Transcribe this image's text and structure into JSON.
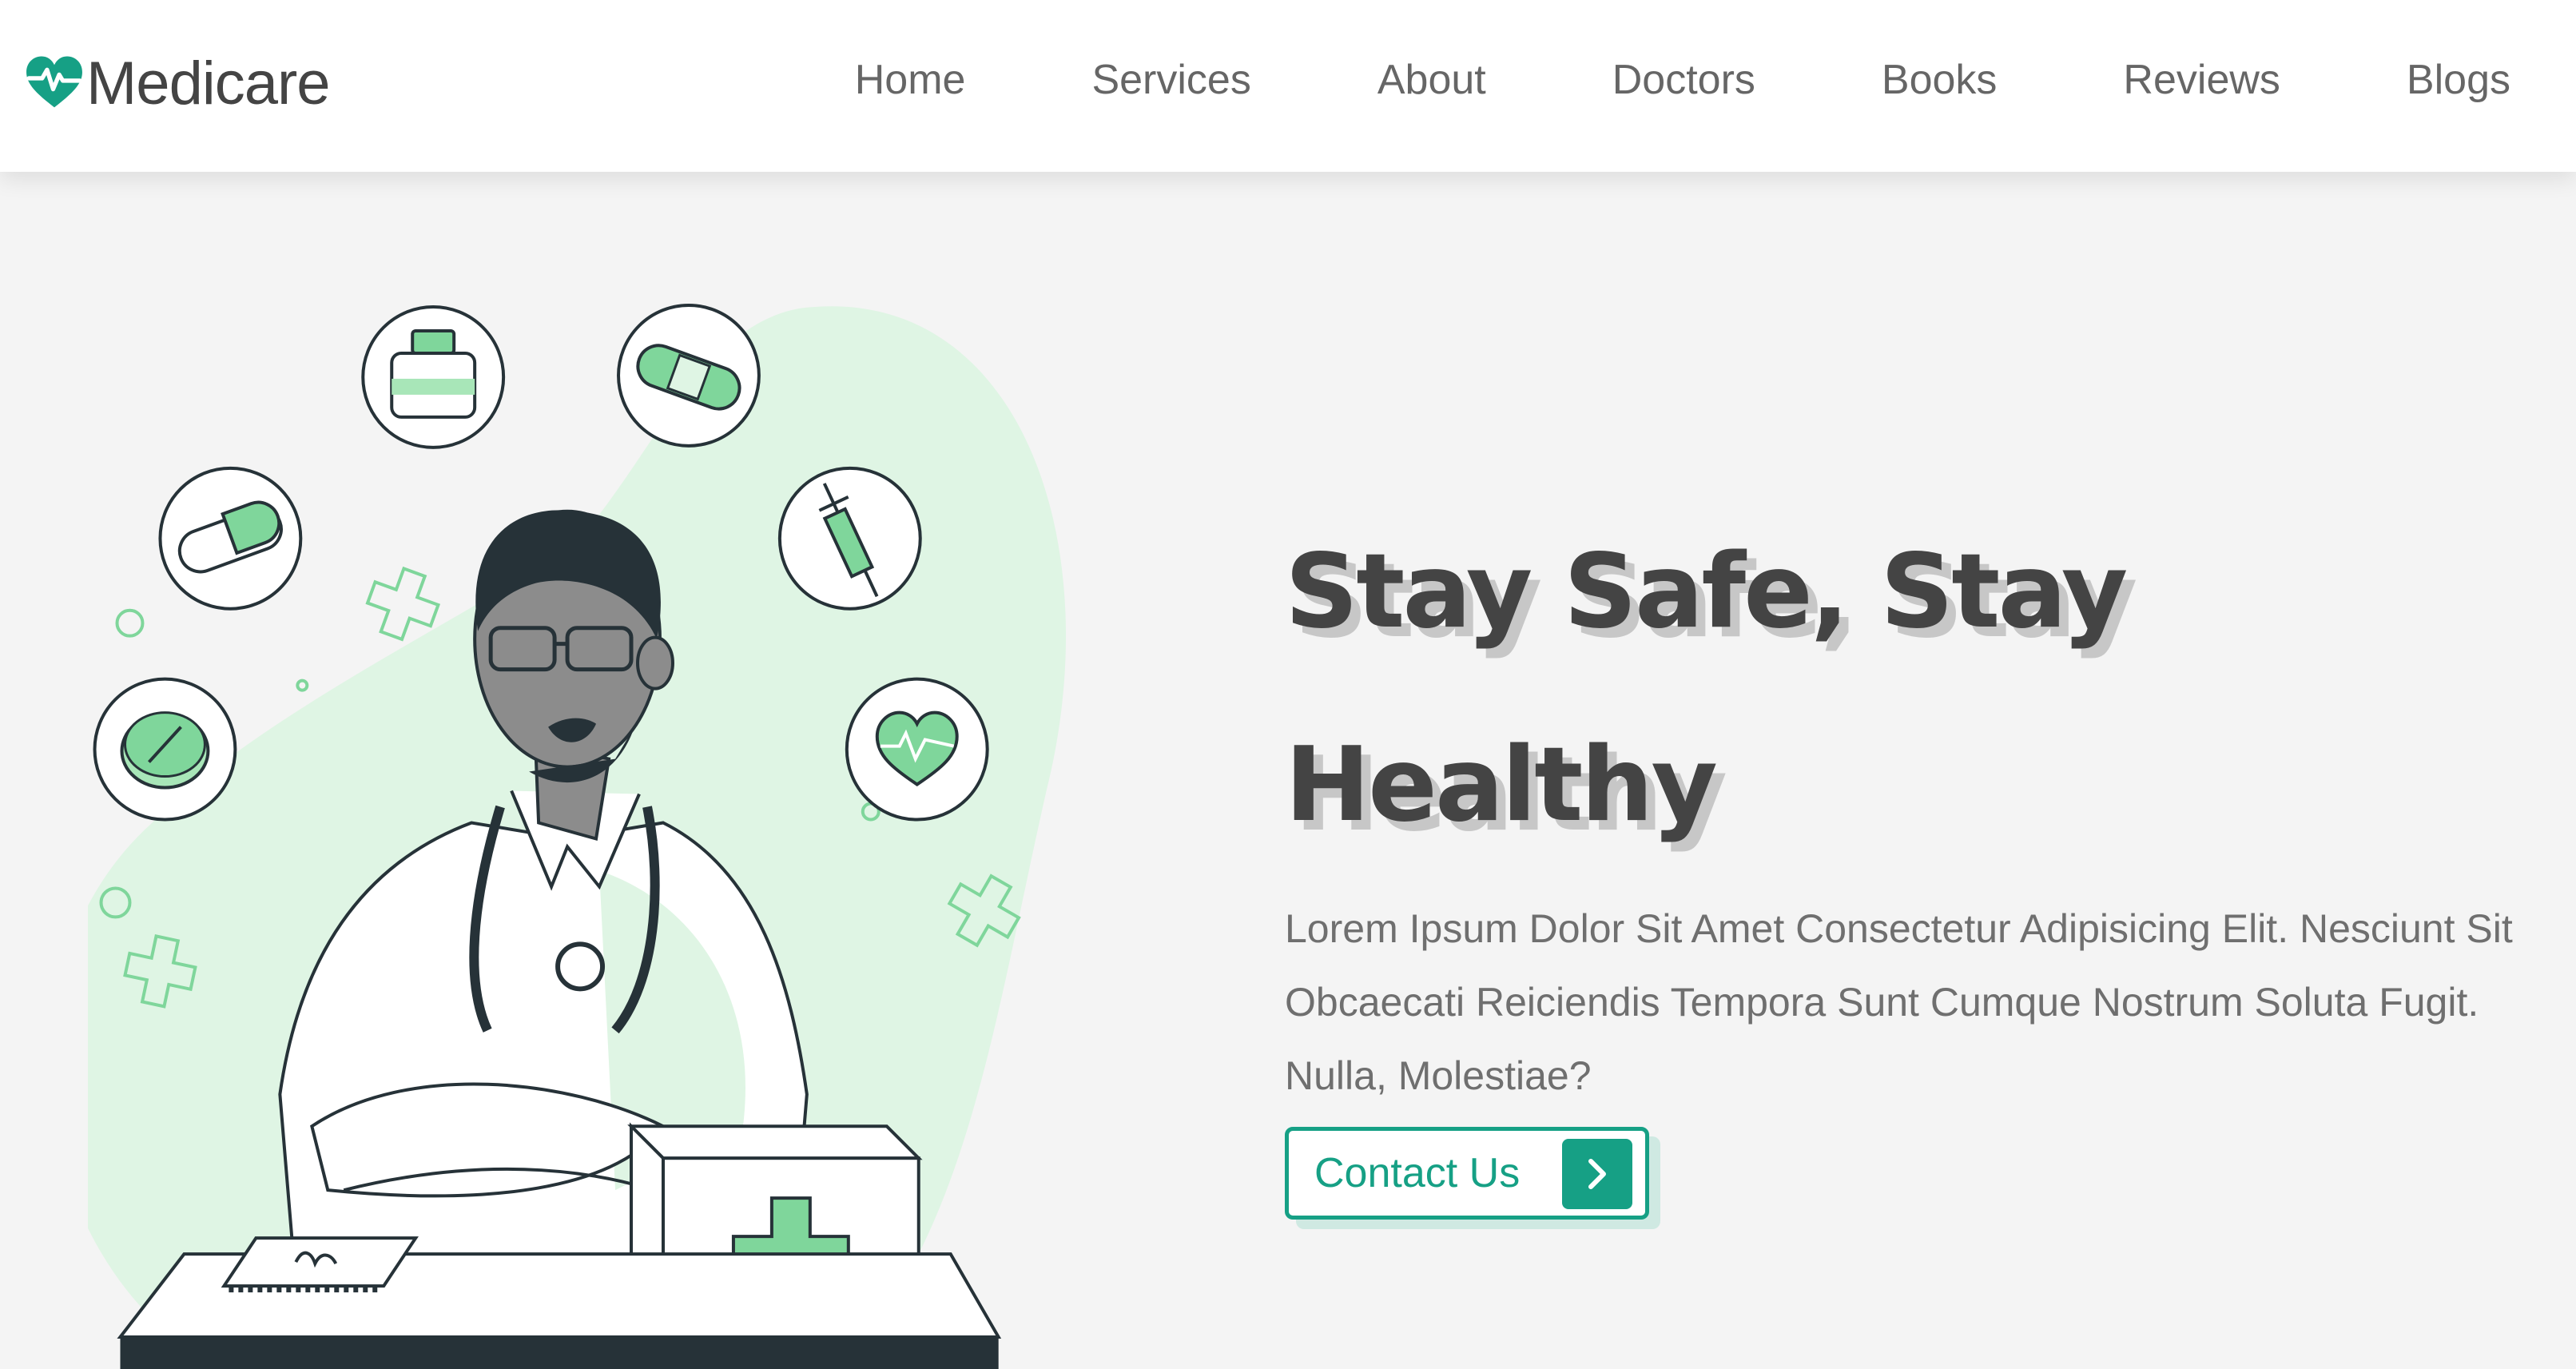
{
  "brand": {
    "name": "Medicare",
    "icon": "heart-pulse-icon",
    "accent_color": "#16a085"
  },
  "nav": {
    "items": [
      {
        "label": "Home"
      },
      {
        "label": "Services"
      },
      {
        "label": "About"
      },
      {
        "label": "Doctors"
      },
      {
        "label": "Books"
      },
      {
        "label": "Reviews"
      },
      {
        "label": "Blogs"
      }
    ]
  },
  "hero": {
    "title": "Stay Safe, Stay Healthy",
    "text": "Lorem Ipsum Dolor Sit Amet Consectetur Adipisicing Elit. Nesciunt Sit Obcaecati Reiciendis Tempora Sunt Cumque Nostrum Soluta Fugit. Nulla, Molestiae?",
    "cta_label": "Contact Us",
    "cta_icon": "chevron-right-icon"
  },
  "illustration": {
    "icons": [
      "medicine-bottle-icon",
      "bandage-icon",
      "capsule-icon",
      "syringe-icon",
      "pill-icon",
      "heart-icon"
    ]
  }
}
